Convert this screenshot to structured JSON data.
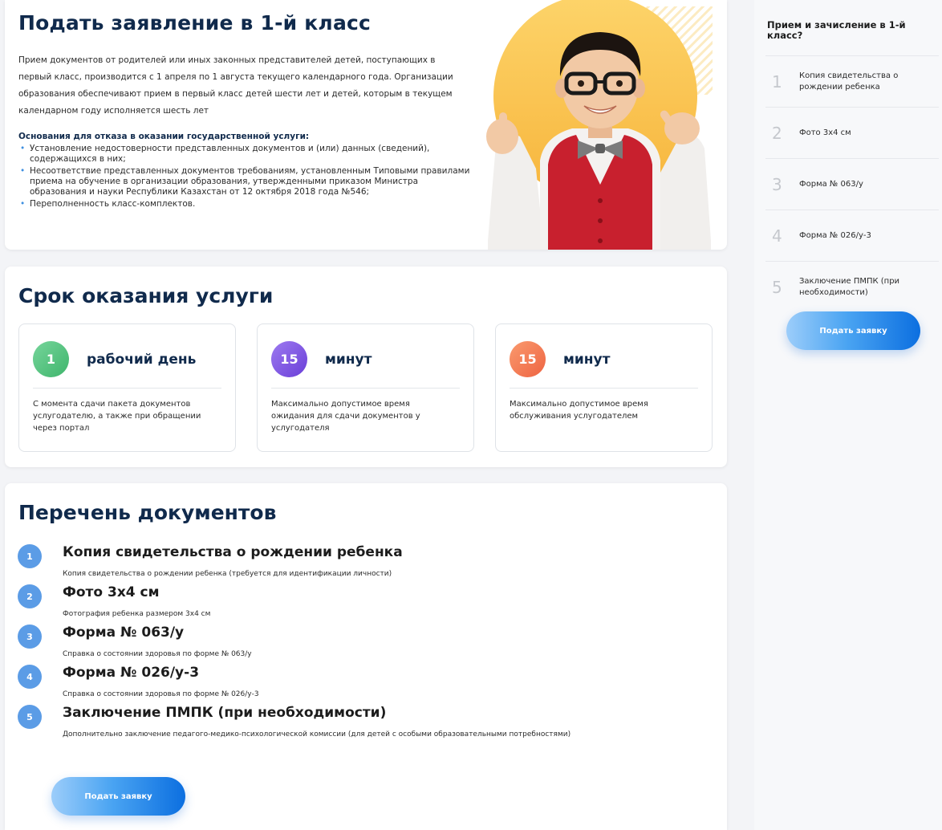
{
  "main": {
    "intro_card": {
      "title": "Подать заявление в 1-й класс",
      "intro": "Прием документов от родителей или иных законных представителей детей, поступающих в первый класс, производится с 1 апреля по 1 августа текущего календарного года. Организации образования обеспечивают прием в первый класс детей шести лет и детей, которым в текущем календарном году исполняется шесть лет",
      "refusal_title": "Основания для отказа в оказании государственной услуги:",
      "refusal_items": [
        "Установление недостоверности представленных документов и (или) данных (сведений), содержащихся в них;",
        "Несоответствие представленных документов требованиям, установленным Типовыми правилами приема на обучение в организации образования, утвержденными приказом Министра образования и науки Республики Казахстан от 12 октября 2018 года №546;",
        "Переполненность класс-комплектов."
      ]
    },
    "terms_card": {
      "title": "Срок оказания услуги",
      "items": [
        {
          "value": "1",
          "unit": "рабочий день",
          "description": "С момента сдачи пакета документов услугодателю, а также при обращении через портал",
          "color": "#4cc07a"
        },
        {
          "value": "15",
          "unit": "минут",
          "description": "Максимально допустимое время ожидания для сдачи документов у услугодателя",
          "color": "#7b52e0"
        },
        {
          "value": "15",
          "unit": "минут",
          "description": "Максимально допустимое время обслуживания услугодателем",
          "color": "#f2734e"
        }
      ]
    },
    "docs_card": {
      "title": "Перечень документов",
      "items": [
        {
          "num": "1",
          "name": "Копия свидетельства о рождении ребенка",
          "note": "Копия свидетельства о рождении ребенка (требуется для идентификации личности)"
        },
        {
          "num": "2",
          "name": "Фото 3х4 см",
          "note": "Фотография ребенка размером 3х4 см"
        },
        {
          "num": "3",
          "name": "Форма № 063/у",
          "note": "Справка о состоянии здоровья по форме № 063/у"
        },
        {
          "num": "4",
          "name": "Форма № 026/у-3",
          "note": "Справка о состоянии здоровья по форме № 026/у-3"
        },
        {
          "num": "5",
          "name": "Заключение ПМПК (при необходимости)",
          "note": "Дополнительно заключение педагого-медико-психологической комиссии (для детей с особыми образовательными потребностями)"
        }
      ],
      "button_label": "Подать заявку"
    }
  },
  "sidebar": {
    "title": "Прием и зачисление в 1-й класс?",
    "items": [
      {
        "num": "1",
        "label": "Копия свидетельства о рождении ребенка"
      },
      {
        "num": "2",
        "label": "Фото 3х4 см"
      },
      {
        "num": "3",
        "label": "Форма № 063/у"
      },
      {
        "num": "4",
        "label": "Форма № 026/у-3"
      },
      {
        "num": "5",
        "label": "Заключение ПМПК (при необходимости)"
      }
    ],
    "button_label": "Подать заявку"
  },
  "colors": {
    "heading": "#102a4c",
    "accent": "#3d8fe0",
    "doc_badge": "#5b9ce6",
    "hero_circle": "#fbc95a"
  }
}
